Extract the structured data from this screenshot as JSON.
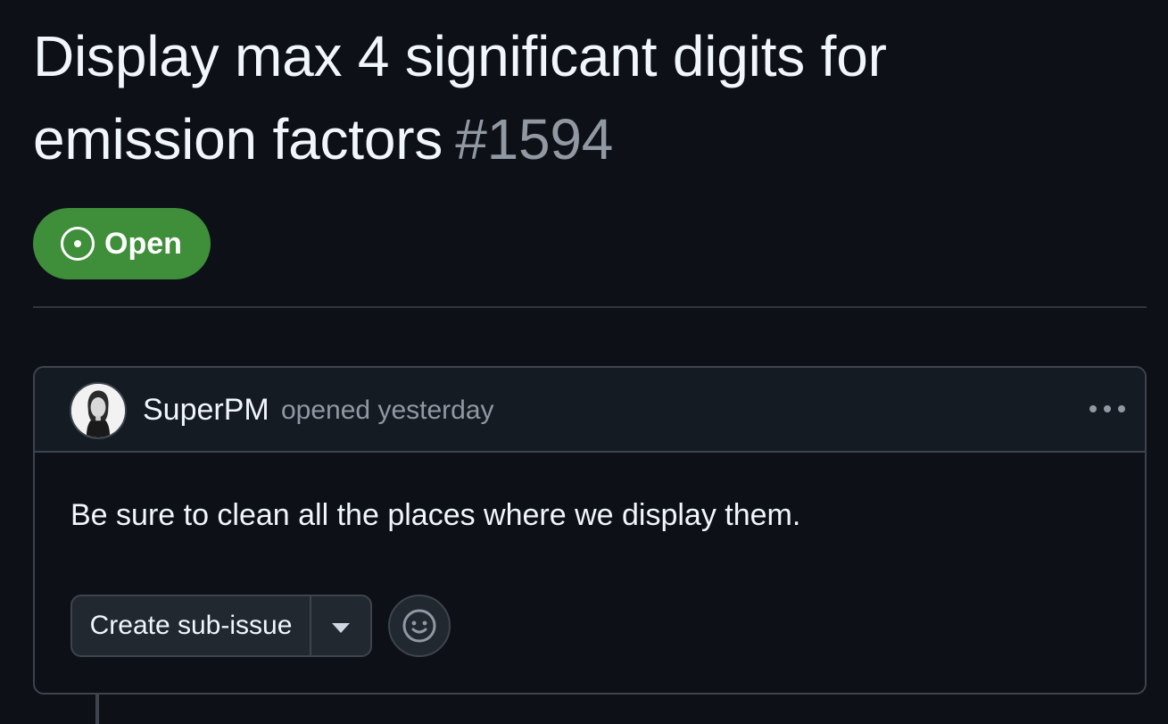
{
  "issue": {
    "title": "Display max 4 significant digits for emission factors",
    "number": "#1594",
    "state": "Open",
    "state_icon": "issue-opened-icon",
    "state_color": "#3e8e3a"
  },
  "comment": {
    "author": "SuperPM",
    "meta": "opened yesterday",
    "body": "Be sure to clean all the places where we display them.",
    "actions": {
      "create_sub_issue_label": "Create sub-issue",
      "dropdown_icon": "triangle-down-icon",
      "reaction_icon": "smiley-icon",
      "more_icon": "kebab-horizontal-icon"
    }
  },
  "colors": {
    "background": "#0d1117",
    "text": "#f0f6fc",
    "muted": "#9198a1",
    "border": "#3d444d",
    "header_bg": "#151b23"
  }
}
